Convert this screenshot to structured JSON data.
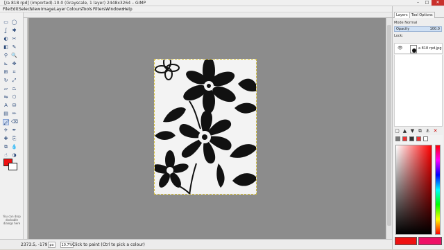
{
  "title_bar": {
    "title": "[/a 818 rpd] (imported)-10.0 (Grayscale, 1 layer) 2448x3264 – GIMP",
    "minimize": "–",
    "maximize": "□",
    "close": "✕"
  },
  "menu": [
    "File",
    "Edit",
    "Select",
    "View",
    "Image",
    "Layer",
    "Colours",
    "Tools",
    "Filters",
    "Windows",
    "Help"
  ],
  "toolbox": {
    "tool_icons": [
      "rect-select",
      "ellipse-select",
      "free-select",
      "fuzzy-select",
      "color-select",
      "scissors",
      "foreground-select",
      "paths",
      "color-picker",
      "zoom",
      "measure",
      "move",
      "align",
      "crop",
      "rotate",
      "scale",
      "shear",
      "perspective",
      "flip",
      "cage",
      "text",
      "bucket-fill",
      "blend",
      "pencil",
      "paintbrush",
      "eraser",
      "airbrush",
      "ink",
      "heal",
      "clone",
      "perspective-clone",
      "blur",
      "smudge",
      "dodge-burn"
    ],
    "hint_text": "You can drop dockable dialogs here",
    "fg_color": "#ee1111",
    "bg_color": "#ffffff"
  },
  "status": {
    "coords": "2373.5, -179.5",
    "unit": "px",
    "zoom": "10.7%",
    "message": "Click to paint (Ctrl to pick a colour)"
  },
  "dock": {
    "tabs": [
      "Layers",
      "Tool Options"
    ],
    "mode_label": "Mode",
    "mode_value": "Normal",
    "opacity_label": "Opacity",
    "opacity_value": "100.0",
    "lock_label": "Lock:",
    "layer_name": "a 818 rpd.jpg",
    "fg_swatch": "#ee1111",
    "hex_swatch": "#ee1166"
  }
}
